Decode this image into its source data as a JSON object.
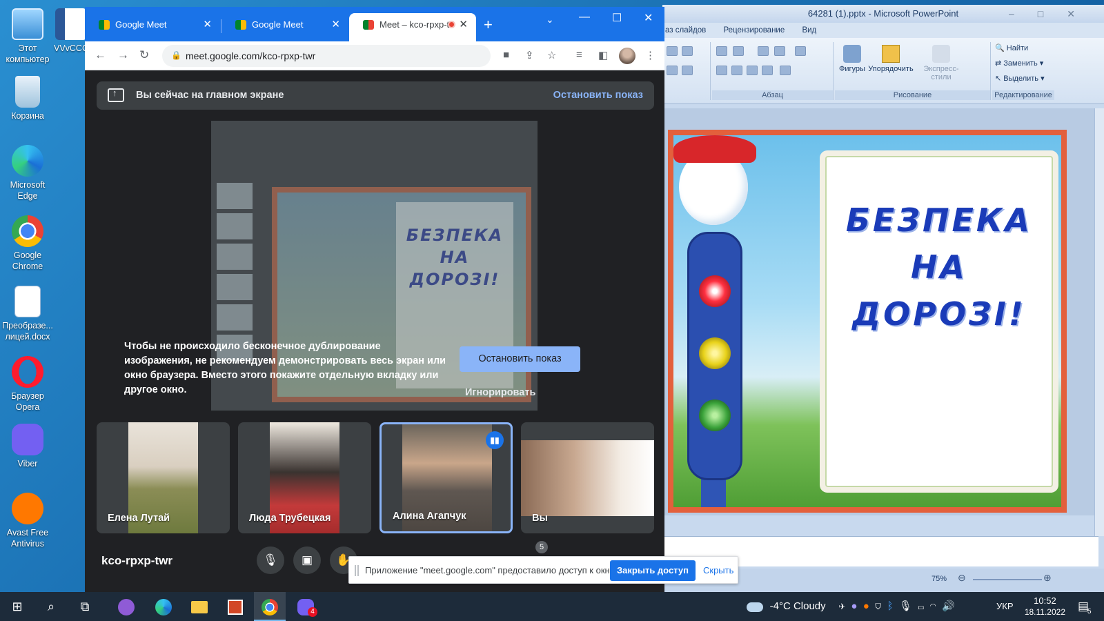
{
  "desktop": {
    "icons": [
      {
        "label": "Этот компьютер"
      },
      {
        "label": "VVvCCC"
      },
      {
        "label": "Корзина"
      },
      {
        "label": "Microsoft Edge"
      },
      {
        "label": "Google Chrome"
      },
      {
        "label": "Преобразе... лицей.docx"
      },
      {
        "label": "Браузер Opera"
      },
      {
        "label": "Viber"
      },
      {
        "label": "Avast Free Antivirus"
      }
    ]
  },
  "powerpoint": {
    "title": "64281 (1).pptx - Microsoft PowerPoint",
    "tabs": [
      "аз слайдов",
      "Рецензирование",
      "Вид"
    ],
    "groups": {
      "paragraph": "Абзац",
      "drawing": "Рисование",
      "editing": "Редактирование"
    },
    "buttons": {
      "shapes": "Фигуры",
      "arrange": "Упорядочить",
      "quick_styles": "Экспресс-стили",
      "find": "Найти",
      "replace": "Заменить",
      "select": "Выделить"
    },
    "slide_text": [
      "БЕЗПЕКА",
      "НА",
      "ДОРОЗІ!"
    ],
    "zoom": "75%"
  },
  "chrome": {
    "tabs": [
      {
        "label": "Google Meet"
      },
      {
        "label": "Google Meet"
      },
      {
        "label": "Meet – kco-rpxp-t"
      }
    ],
    "url": "meet.google.com/kco-rpxp-twr"
  },
  "meet": {
    "banner_text": "Вы сейчас на главном экране",
    "banner_stop": "Остановить показ",
    "warning": "Чтобы не происходило бесконечное дублирование изображения, не рекомендуем демонстрировать весь экран или окно браузера. Вместо этого покажите отдельную вкладку или другое окно.",
    "stop_button": "Остановить показ",
    "ignore_button": "Игнорировать",
    "participants": [
      {
        "name": "Елена Лутай"
      },
      {
        "name": "Люда Трубецкая"
      },
      {
        "name": "Алина Агапчук"
      },
      {
        "name": "Вы"
      }
    ],
    "meeting_code": "kco-rpxp-twr",
    "people_count": "5"
  },
  "share_notice": {
    "text": "Приложение \"meet.google.com\" предоставило доступ к окну.",
    "close_button": "Закрыть доступ",
    "hide_button": "Скрыть"
  },
  "taskbar": {
    "weather": "-4°C  Cloudy",
    "language": "УКР",
    "time": "10:52",
    "date": "18.11.2022",
    "viber_badge": "4",
    "notif_count": "5"
  },
  "colors": {
    "meet_bg": "#202124",
    "chrome_accent": "#1a73e8",
    "meet_button": "#8ab4f8"
  }
}
